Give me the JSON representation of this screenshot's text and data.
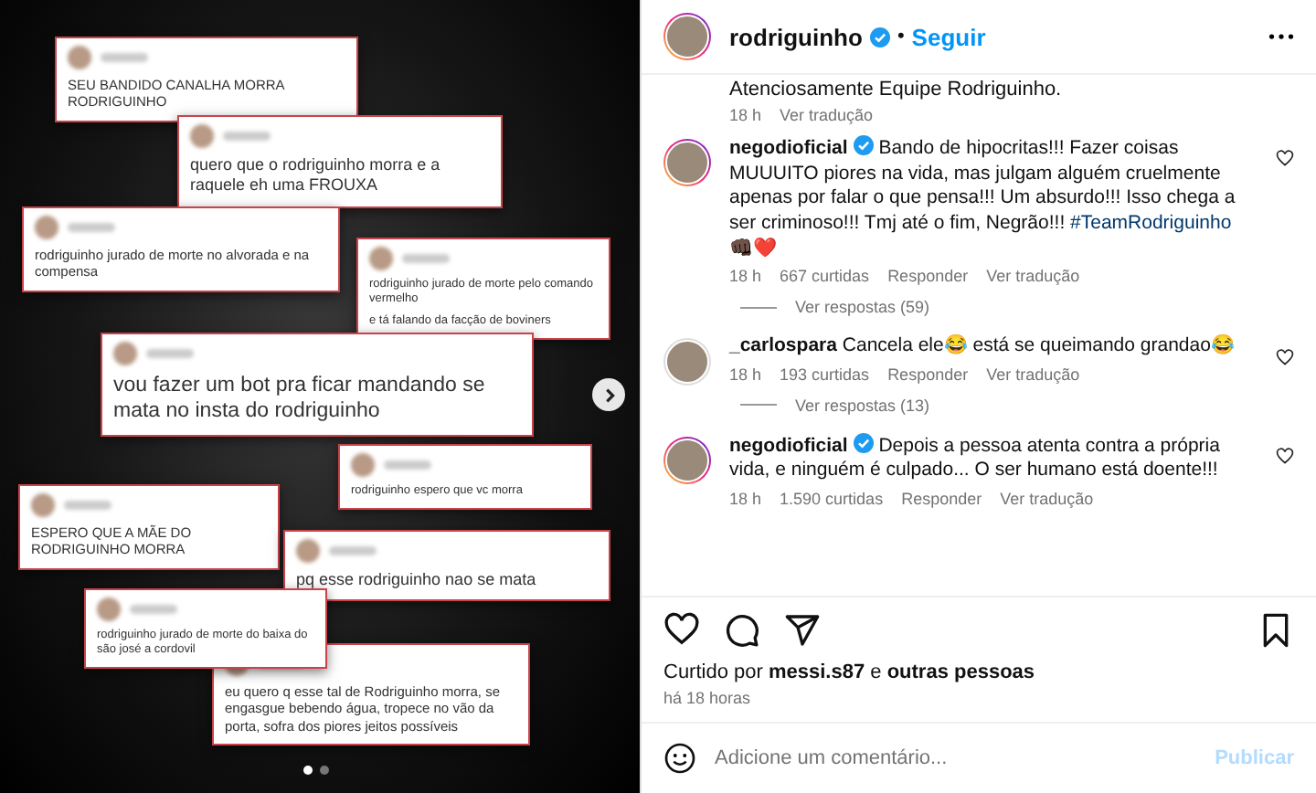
{
  "post_image": {
    "cards": [
      {
        "text": "SEU BANDIDO CANALHA MORRA RODRIGUINHO"
      },
      {
        "text": "quero que o rodriguinho morra e a raquele eh uma FROUXA"
      },
      {
        "text": "rodriguinho jurado de morte no alvorada e na compensa"
      },
      {
        "text": "rodriguinho jurado de morte pelo comando vermelho",
        "extra": "e tá falando da facção de boviners"
      },
      {
        "text": "vou fazer um bot pra ficar mandando se mata no insta do rodriguinho"
      },
      {
        "text": "rodriguinho espero que vc morra"
      },
      {
        "text": "ESPERO QUE A MÃE DO RODRIGUINHO MORRA"
      },
      {
        "text": "pq esse rodriguinho nao se mata"
      },
      {
        "text": "rodriguinho jurado de morte do baixa do são josé a cordovil"
      },
      {
        "text": "eu quero q esse tal de Rodriguinho morra, se engasgue bebendo água, tropece no vão da porta, sofra dos piores jeitos possíveis"
      }
    ],
    "dots": [
      {
        "selected": true
      },
      {
        "selected": false
      }
    ]
  },
  "header": {
    "username": "rodriguinho",
    "verified": true,
    "separator": "•",
    "follow": "Seguir"
  },
  "caption": {
    "text": "Atenciosamente Equipe Rodriguinho.",
    "time": "18 h",
    "translate": "Ver tradução"
  },
  "comments": [
    {
      "user": "negodioficial",
      "verified": true,
      "ring": true,
      "parts": [
        {
          "kind": "text",
          "text": "Bando de hipocritas!!! Fazer coisas MUUUITO piores na vida, mas julgam alguém cruelmente apenas por falar o que pensa!!! Um absurdo!!! Isso chega a ser criminoso!!! Tmj até o fim, Negrão!!! "
        },
        {
          "kind": "hashtag",
          "text": "#TeamRodriguinho"
        },
        {
          "kind": "text",
          "text": " 👊🏿❤️"
        }
      ],
      "time": "18 h",
      "likes": "667 curtidas",
      "reply": "Responder",
      "translate": "Ver tradução",
      "liked": false,
      "replies": "Ver respostas (59)"
    },
    {
      "user": "_carlospara",
      "verified": false,
      "ring": false,
      "parts": [
        {
          "kind": "text",
          "text": "Cancela ele😂 está se queimando grandao😂"
        }
      ],
      "time": "18 h",
      "likes": "193 curtidas",
      "reply": "Responder",
      "translate": "Ver tradução",
      "liked": false,
      "replies": "Ver respostas (13)"
    },
    {
      "user": "negodioficial",
      "verified": true,
      "ring": true,
      "parts": [
        {
          "kind": "text",
          "text": "Depois a pessoa atenta contra a própria vida, e ninguém é culpado... O ser humano está doente!!!"
        }
      ],
      "time": "18 h",
      "likes": "1.590 curtidas",
      "reply": "Responder",
      "translate": "Ver tradução",
      "liked": false
    }
  ],
  "likes": {
    "prefix": "Curtido por ",
    "user": "messi.s87",
    "middle": " e ",
    "others": "outras pessoas"
  },
  "time_ago": "há 18 horas",
  "comment_box": {
    "placeholder": "Adicione um comentário...",
    "post": "Publicar",
    "disabled": true
  }
}
